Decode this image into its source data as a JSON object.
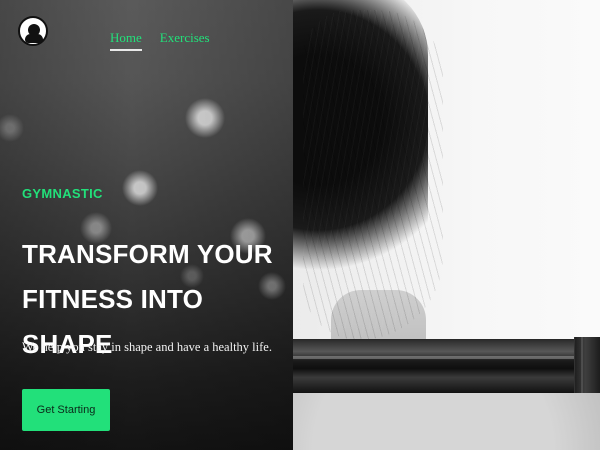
{
  "brand": {
    "logo_icon": "bodybuilder-logo-icon"
  },
  "nav": {
    "items": [
      {
        "label": "Home",
        "active": true
      },
      {
        "label": "Exercises",
        "active": false
      }
    ]
  },
  "hero": {
    "eyebrow": "GYMNASTIC",
    "headline_line1": "TRANSFORM YOUR",
    "headline_line2": "FITNESS INTO SHAPE",
    "subtext": "We help you stay in shape and have a healthy life.",
    "cta_label": "Get Starting"
  },
  "colors": {
    "accent_green": "#22E07A",
    "text_white": "#FFFFFF",
    "nav_underline": "#E9E9E9"
  }
}
